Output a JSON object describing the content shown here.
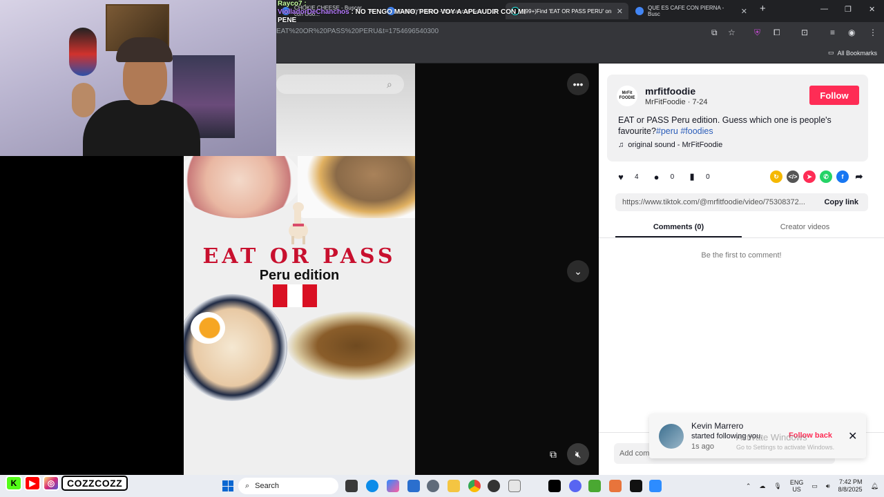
{
  "browser": {
    "tabs": [
      {
        "title": "CHOKIE CHEESE - Buscar con Goo..."
      },
      {
        "title": "GARRY'S MOD - Buscar con Goo..."
      },
      {
        "title": "(99+)Find 'EAT OR PASS PERU' on"
      },
      {
        "title": "QUE ES CAFE CON PIERNA - Busc"
      }
    ],
    "url": "EAT%20OR%20PASS%20PERU&t=1754696540300",
    "all_bookmarks": "All Bookmarks"
  },
  "chat": {
    "line1_user": "Rayco7 :",
    "line2_user": "ViolladorDeChanchos",
    "line2_text": ": NO TENGO MANO, PERO VOY A APLAUDIR CON MI",
    "line3_text": "PENE"
  },
  "video": {
    "title": "EAT OR PASS",
    "subtitle": "Peru edition",
    "colors": {
      "flag_red": "#d91023",
      "flag_white": "#ffffff",
      "title_red": "#c8102e"
    }
  },
  "post": {
    "avatar_text": "MrFit FOODIE",
    "username": "mrfitfoodie",
    "display_name": "MrFitFoodie",
    "date": "7-24",
    "follow_label": "Follow",
    "description": "EAT or PASS Peru edition. Guess which one is people's favourite?",
    "tags": "#peru #foodies",
    "sound": "original sound - MrFitFoodie",
    "likes": "4",
    "comments": "0",
    "saves": "0",
    "link": "https://www.tiktok.com/@mrfitfoodie/video/75308372...",
    "copy_link": "Copy link",
    "tab_comments": "Comments (0)",
    "tab_creator": "Creator videos",
    "empty_comments": "Be the first to comment!",
    "add_comment": "Add comment..."
  },
  "notification": {
    "name": "Kevin Marrero",
    "text": "started following you.",
    "time": "1s ago",
    "action": "Follow back"
  },
  "activate_windows": {
    "line1": "Activate Windows",
    "line2": "Go to Settings to activate Windows."
  },
  "taskbar": {
    "brand": "COZZCOZZ",
    "search": "Search",
    "lang_top": "ENG",
    "lang_bottom": "US",
    "time": "7:42 PM",
    "date": "8/8/2025"
  }
}
